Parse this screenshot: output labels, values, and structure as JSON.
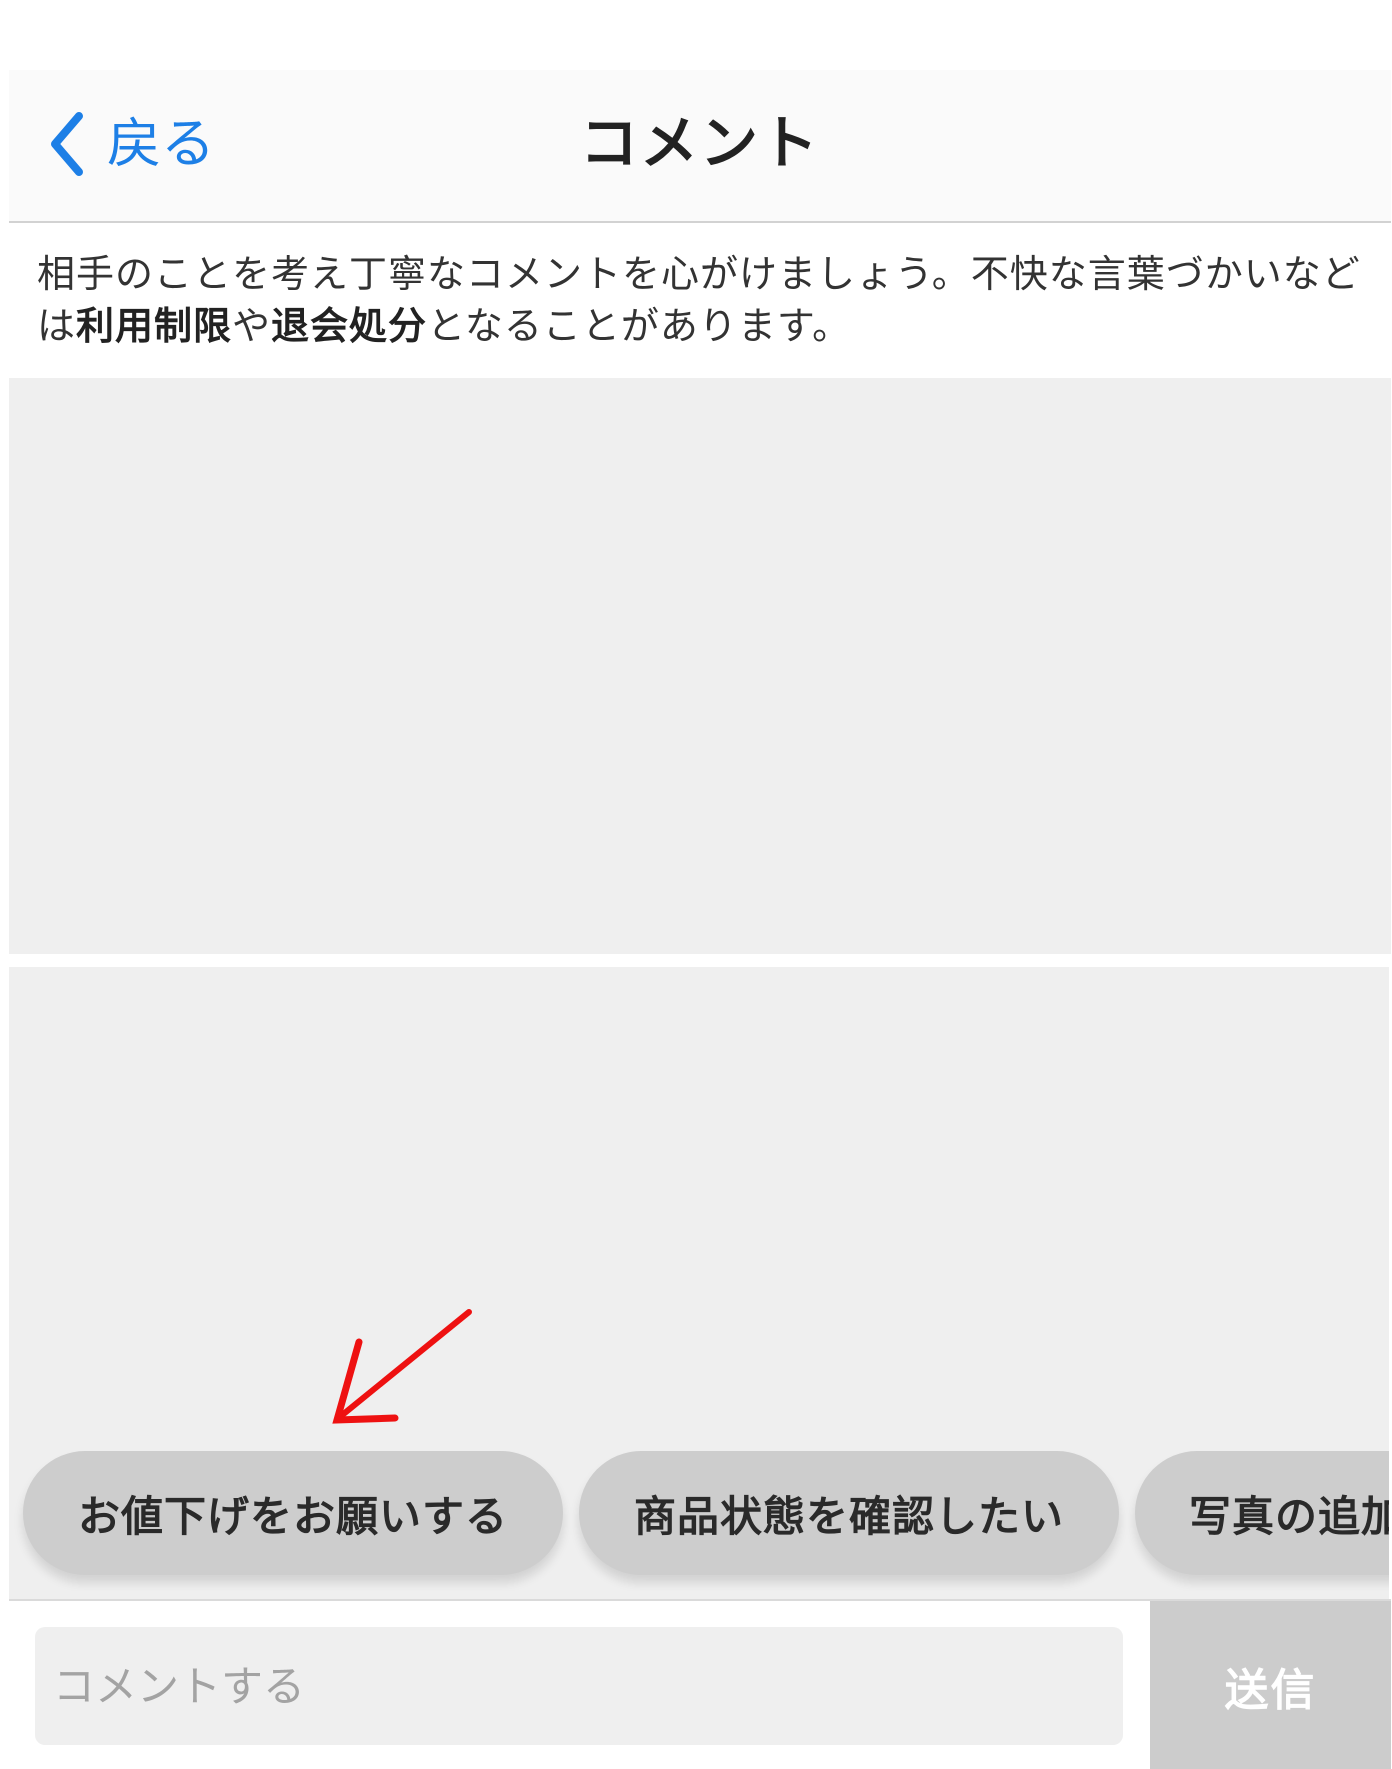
{
  "header": {
    "back_label": "戻る",
    "title": "コメント"
  },
  "notice": {
    "part1": "相手のことを考え丁寧なコメントを心がけましょう。不快な言葉づかいなどは",
    "bold1": "利用制限",
    "part2": "や",
    "bold2": "退会処分",
    "part3": "となることがあります。"
  },
  "quick_replies": [
    "お値下げをお願いする",
    "商品状態を確認したい",
    "写真の追加"
  ],
  "composer": {
    "placeholder": "コメントする",
    "send_label": "送信"
  },
  "colors": {
    "accent": "#1d7fe6",
    "annotation_arrow": "#ee1111",
    "chip_background": "#cdcdcd",
    "send_disabled": "#cccccc",
    "panel_background": "#efefef"
  },
  "icons": {
    "back": "chevron-left-icon",
    "annotation": "red-arrow-icon"
  }
}
